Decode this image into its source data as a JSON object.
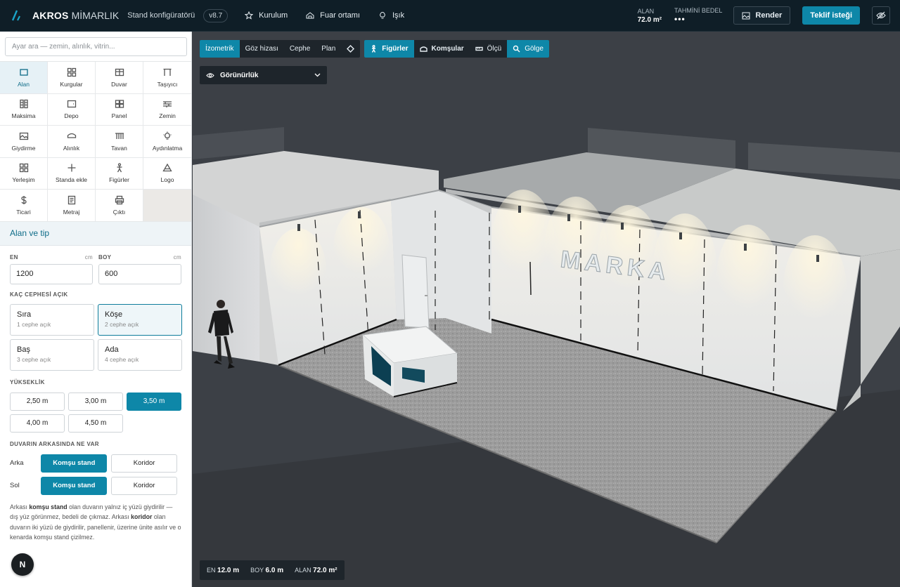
{
  "topbar": {
    "brand": "AKROS",
    "brand_sub": "MİMARLIK",
    "app_title": "Stand konfigüratörü",
    "version": "v8.7",
    "nav": [
      {
        "label": "Kurulum",
        "icon": "star-icon"
      },
      {
        "label": "Fuar ortamı",
        "icon": "building-icon"
      },
      {
        "label": "Işık",
        "icon": "bulb-icon"
      }
    ],
    "area_label": "ALAN",
    "area_value": "72.0 m²",
    "cost_label": "TAHMİNİ BEDEL",
    "cost_value": "•••",
    "render_label": "Render",
    "quote_label": "Teklif isteği"
  },
  "sidebar": {
    "search_placeholder": "Ayar ara — zemin, alınlık, vitrin...",
    "tools": [
      {
        "label": "Alan",
        "icon": "area-icon",
        "active": true
      },
      {
        "label": "Kurgular",
        "icon": "layouts-icon"
      },
      {
        "label": "Duvar",
        "icon": "wall-icon"
      },
      {
        "label": "Taşıyıcı",
        "icon": "truss-icon"
      },
      {
        "label": "Maksima",
        "icon": "maxima-icon"
      },
      {
        "label": "Depo",
        "icon": "storage-icon"
      },
      {
        "label": "Panel",
        "icon": "panel-icon"
      },
      {
        "label": "Zemin",
        "icon": "floor-icon"
      },
      {
        "label": "Giydirme",
        "icon": "image-icon"
      },
      {
        "label": "Alınlık",
        "icon": "fascia-icon"
      },
      {
        "label": "Tavan",
        "icon": "ceiling-icon"
      },
      {
        "label": "Aydınlatma",
        "icon": "lighting-icon"
      },
      {
        "label": "Yerleşim",
        "icon": "placement-icon"
      },
      {
        "label": "Standa ekle",
        "icon": "plus-icon"
      },
      {
        "label": "Figürler",
        "icon": "person-icon"
      },
      {
        "label": "Logo",
        "icon": "logo-triangle-icon"
      },
      {
        "label": "Ticari",
        "icon": "dollar-icon"
      },
      {
        "label": "Metraj",
        "icon": "document-icon"
      },
      {
        "label": "Çıktı",
        "icon": "printer-icon"
      }
    ],
    "section_title": "Alan ve tip",
    "width_label": "EN",
    "width_unit": "cm",
    "width_value": "1200",
    "depth_label": "BOY",
    "depth_unit": "cm",
    "depth_value": "600",
    "open_sides_title": "KAÇ CEPHESİ AÇIK",
    "open_sides": [
      {
        "title": "Sıra",
        "sub": "1 cephe açık",
        "selected": false
      },
      {
        "title": "Köşe",
        "sub": "2 cephe açık",
        "selected": true
      },
      {
        "title": "Baş",
        "sub": "3 cephe açık",
        "selected": false
      },
      {
        "title": "Ada",
        "sub": "4 cephe açık",
        "selected": false
      }
    ],
    "height_title": "YÜKSEKLİK",
    "heights": [
      {
        "label": "2,50 m",
        "selected": false
      },
      {
        "label": "3,00 m",
        "selected": false
      },
      {
        "label": "3,50 m",
        "selected": true
      },
      {
        "label": "4,00 m",
        "selected": false
      },
      {
        "label": "4,50 m",
        "selected": false
      }
    ],
    "behind_title": "DUVARIN ARKASINDA NE VAR",
    "walls": [
      {
        "label": "Arka",
        "neighbor": "Komşu stand",
        "corridor": "Koridor"
      },
      {
        "label": "Sol",
        "neighbor": "Komşu stand",
        "corridor": "Koridor"
      }
    ],
    "note_1": "Arkası ",
    "note_b1": "komşu stand",
    "note_2": " olan duvarın yalnız iç yüzü giydirilir — dış yüz görünmez, bedeli de çıkmaz. Arkası ",
    "note_b2": "koridor",
    "note_3": " olan duvarın iki yüzü de giydirilir, panellenir, üzerine ünite asılır ve o kenarda komşu stand çizilmez.",
    "badge": "N"
  },
  "viewport": {
    "views": [
      "İzometrik",
      "Göz hizası",
      "Cephe",
      "Plan"
    ],
    "active_view": "İzometrik",
    "toggles": [
      {
        "label": "Figürler",
        "icon": "person-icon",
        "on": true
      },
      {
        "label": "Komşular",
        "icon": "neighbors-icon",
        "on": false
      },
      {
        "label": "Ölçü",
        "icon": "ruler-icon",
        "on": false
      },
      {
        "label": "Gölge",
        "icon": "shadow-icon",
        "on": true
      }
    ],
    "visibility_label": "Görünürlük",
    "logo_text": "MARKA",
    "dims": {
      "w_label": "EN",
      "w_value": "12.0 m",
      "d_label": "BOY",
      "d_value": "6.0 m",
      "a_label": "ALAN",
      "a_value": "72.0 m²"
    }
  },
  "colors": {
    "accent": "#0e87a8",
    "topbar": "#0f1e27",
    "viewport_bg": "#3c4046"
  }
}
